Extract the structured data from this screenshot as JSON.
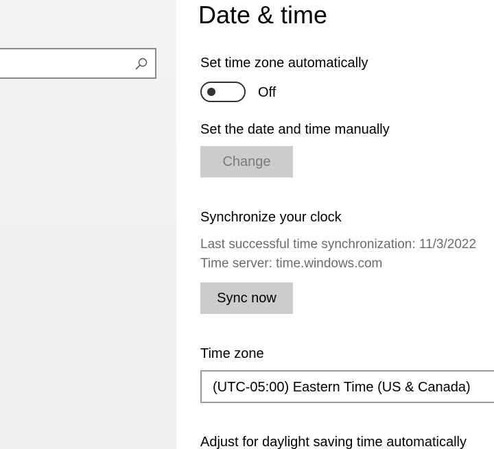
{
  "search": {
    "placeholder": "",
    "icon": "search-icon"
  },
  "page": {
    "title": "Date & time"
  },
  "auto_timezone": {
    "label": "Set time zone automatically",
    "toggle_state": "Off",
    "toggle_on": false
  },
  "manual_datetime": {
    "label": "Set the date and time manually",
    "button_label": "Change"
  },
  "sync": {
    "heading": "Synchronize your clock",
    "last_sync": "Last successful time synchronization: 11/3/2022",
    "time_server": "Time server: time.windows.com",
    "button_label": "Sync now"
  },
  "time_zone": {
    "label": "Time zone",
    "selected": "(UTC-05:00) Eastern Time (US & Canada)"
  },
  "daylight_saving": {
    "label": "Adjust for daylight saving time automatically"
  }
}
